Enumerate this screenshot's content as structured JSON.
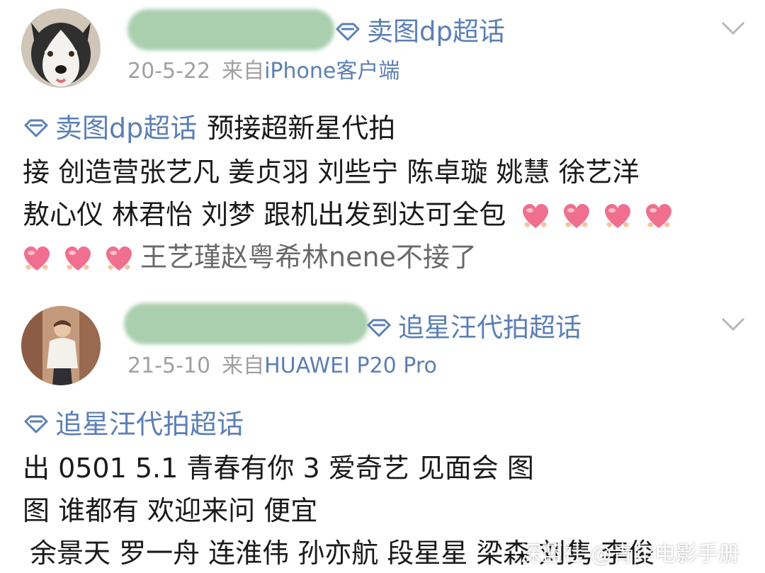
{
  "colors": {
    "topic_blue": "#5b7fb5",
    "meta_gray": "#a0a0a0",
    "text": "#1a1a1a",
    "blur_green": "#a9cfae"
  },
  "posts": [
    {
      "topic_tag": "卖图dp超话",
      "date": "20-5-22",
      "source_prefix": "来自",
      "source_device": "iPhone客户端",
      "body_topic": "卖图dp超话",
      "body_after_topic": "预接超新星代拍",
      "line_2": "接 创造营张艺凡 姜贞羽 刘些宁 陈卓璇  姚慧 徐艺洋",
      "line_3": "敖心仪 林君怡  刘梦 跟机出发到达可全包",
      "line_4": "王艺瑾赵粤希林nene不接了",
      "icons": [
        "avatar-husky",
        "diamond-icon",
        "chevron-down-icon",
        "heart-icon"
      ]
    },
    {
      "topic_tag": "追星汪代拍超话",
      "date": "21-5-10",
      "source_prefix": "来自",
      "source_device": "HUAWEI P20 Pro",
      "body_topic": "追星汪代拍超话",
      "line_2": "出 0501 5.1 青春有你 3 爱奇艺 见面会 图",
      "line_3": "图 谁都有 欢迎来问 便宜",
      "line_4": "余景天 罗一舟 连淮伟 孙亦航 段星星 梁森 刘隽  李俊",
      "icons": [
        "avatar-person",
        "diamond-icon",
        "chevron-down-icon"
      ]
    }
  ],
  "watermark": "深蓝社 @青年电影手册"
}
